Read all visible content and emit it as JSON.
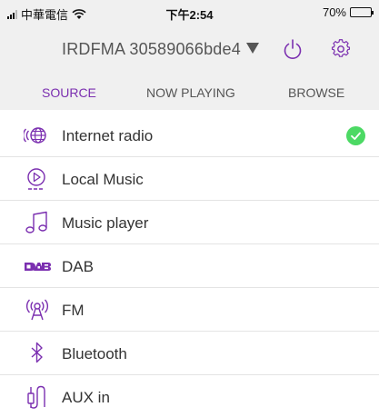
{
  "status_bar": {
    "carrier": "中華電信",
    "time": "下午2:54",
    "battery_percent": "70%",
    "battery_level": 0.7
  },
  "device": {
    "name": "IRDFMA 30589066bde4"
  },
  "tabs": [
    {
      "label": "SOURCE",
      "active": true
    },
    {
      "label": "NOW PLAYING",
      "active": false
    },
    {
      "label": "BROWSE",
      "active": false
    }
  ],
  "sources": [
    {
      "label": "Internet radio",
      "icon": "internet-radio-icon",
      "selected": true
    },
    {
      "label": "Local Music",
      "icon": "local-music-icon",
      "selected": false
    },
    {
      "label": "Music player",
      "icon": "music-player-icon",
      "selected": false
    },
    {
      "label": "DAB",
      "icon": "dab-icon",
      "selected": false
    },
    {
      "label": "FM",
      "icon": "fm-icon",
      "selected": false
    },
    {
      "label": "Bluetooth",
      "icon": "bluetooth-icon",
      "selected": false
    },
    {
      "label": "AUX in",
      "icon": "aux-in-icon",
      "selected": false
    }
  ],
  "colors": {
    "accent": "#7b2fb0",
    "check": "#4cd964",
    "header_bg": "#f0f0f0"
  }
}
